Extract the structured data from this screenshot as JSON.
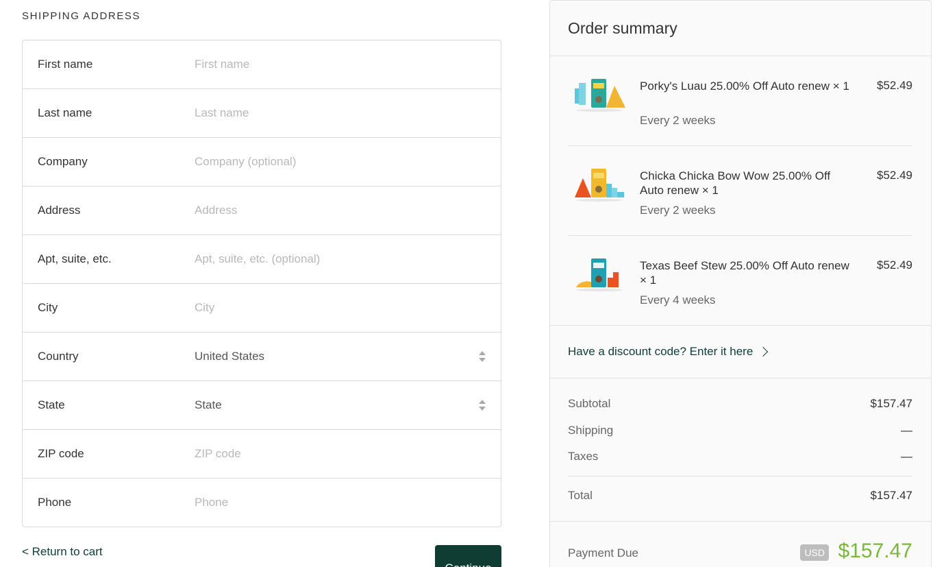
{
  "shipping": {
    "section_title": "SHIPPING ADDRESS",
    "fields": {
      "first_name": {
        "label": "First name",
        "placeholder": "First name"
      },
      "last_name": {
        "label": "Last name",
        "placeholder": "Last name"
      },
      "company": {
        "label": "Company",
        "placeholder": "Company (optional)"
      },
      "address": {
        "label": "Address",
        "placeholder": "Address"
      },
      "apt": {
        "label": "Apt, suite, etc.",
        "placeholder": "Apt, suite, etc. (optional)"
      },
      "city": {
        "label": "City",
        "placeholder": "City"
      },
      "country": {
        "label": "Country",
        "value": "United States"
      },
      "state": {
        "label": "State",
        "value": "State"
      },
      "zip": {
        "label": "ZIP code",
        "placeholder": "ZIP code"
      },
      "phone": {
        "label": "Phone",
        "placeholder": "Phone"
      }
    },
    "return_link": "< Return to cart",
    "continue_label": "Continue"
  },
  "summary": {
    "title": "Order summary",
    "items": [
      {
        "name": "Porky's Luau 25.00% Off Auto renew × 1",
        "frequency": "Every 2 weeks",
        "price": "$52.49",
        "icon": "porkys-luau-product-thumbnail"
      },
      {
        "name": "Chicka Chicka Bow Wow 25.00% Off Auto renew × 1",
        "frequency": "Every 2 weeks",
        "price": "$52.49",
        "icon": "chicka-chicka-product-thumbnail"
      },
      {
        "name": "Texas Beef Stew 25.00% Off Auto renew × 1",
        "frequency": "Every 4 weeks",
        "price": "$52.49",
        "icon": "texas-beef-stew-product-thumbnail"
      }
    ],
    "discount_link": "Have a discount code? Enter it here",
    "subtotal": {
      "label": "Subtotal",
      "value": "$157.47"
    },
    "shipping": {
      "label": "Shipping",
      "value": "—"
    },
    "taxes": {
      "label": "Taxes",
      "value": "—"
    },
    "total": {
      "label": "Total",
      "value": "$157.47"
    },
    "payment_due": {
      "label": "Payment Due",
      "currency": "USD",
      "value": "$157.47"
    }
  },
  "colors": {
    "brand": "#0f3d33",
    "amount_green": "#7ab839",
    "border": "#d9d9d9",
    "summary_bg": "#fafafa"
  }
}
